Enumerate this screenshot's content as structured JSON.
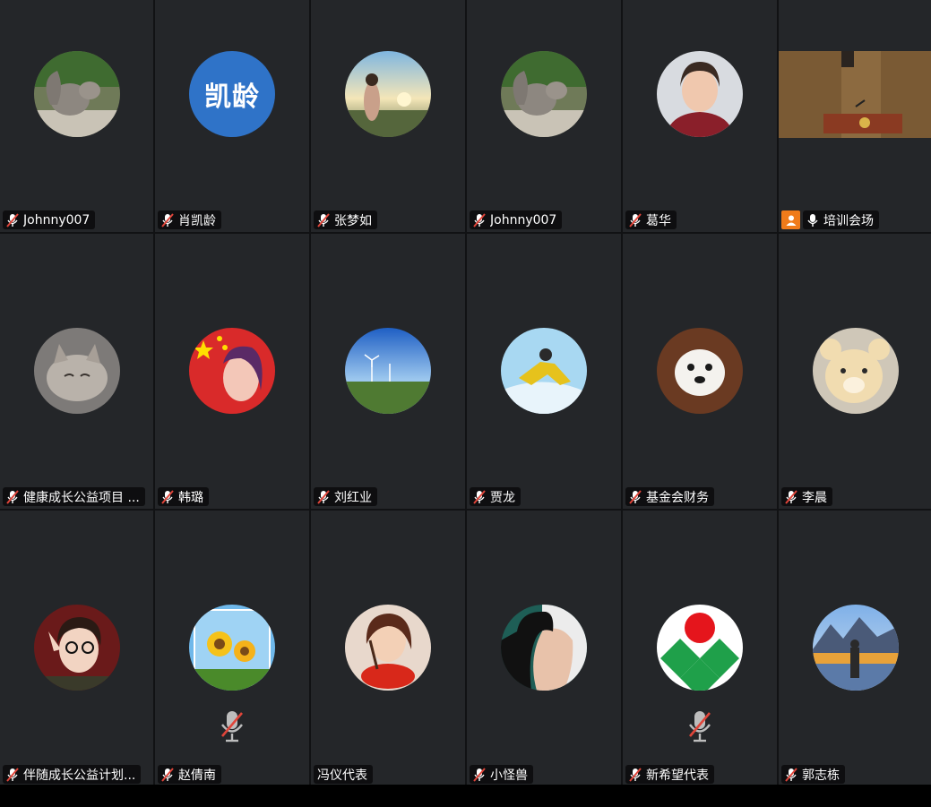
{
  "participants": [
    {
      "name": "Johnny007",
      "muted": true,
      "avatar": "squirrel-photo"
    },
    {
      "name": "肖凯龄",
      "muted": true,
      "avatar_text": "凯龄"
    },
    {
      "name": "张梦如",
      "muted": true,
      "avatar": "woman-sunset-photo"
    },
    {
      "name": "Johnny007",
      "muted": true,
      "avatar": "squirrel-photo"
    },
    {
      "name": "葛华",
      "muted": true,
      "avatar": "older-woman-portrait"
    },
    {
      "name": "培训会场",
      "muted": false,
      "host": true,
      "video": "podium-room-video"
    },
    {
      "name": "健康成长公益项目 ...",
      "muted": true,
      "avatar": "sleeping-cat-photo"
    },
    {
      "name": "韩璐",
      "muted": true,
      "avatar": "flag-girl-illustration"
    },
    {
      "name": "刘红业",
      "muted": true,
      "avatar": "wind-turbines-photo"
    },
    {
      "name": "贾龙",
      "muted": true,
      "avatar": "skydiver-photo"
    },
    {
      "name": "基金会财务",
      "muted": true,
      "avatar": "white-dog-photo"
    },
    {
      "name": "李晨",
      "muted": true,
      "avatar": "teddy-bear-photo"
    },
    {
      "name": "伴随成长公益计划...",
      "muted": true,
      "avatar": "girl-glasses-photo"
    },
    {
      "name": "赵倩南",
      "muted": true,
      "avatar": "sunflowers-photo",
      "center_muted_icon": true
    },
    {
      "name": "冯仪代表",
      "muted": null,
      "avatar": "cartoon-girl-cooking"
    },
    {
      "name": "小怪兽",
      "muted": true,
      "avatar": "woman-profile-photo"
    },
    {
      "name": "新希望代表",
      "muted": true,
      "avatar": "green-red-logo",
      "center_muted_icon": true
    },
    {
      "name": "郭志栋",
      "muted": true,
      "avatar": "mountain-lake-photo"
    }
  ],
  "colors": {
    "tile_bg": "#242629",
    "namebar_bg": "#0a0a0c",
    "muted_red": "#e0453a",
    "host_orange": "#f07b1a",
    "text_avatar_blue": "#2f73c8"
  }
}
